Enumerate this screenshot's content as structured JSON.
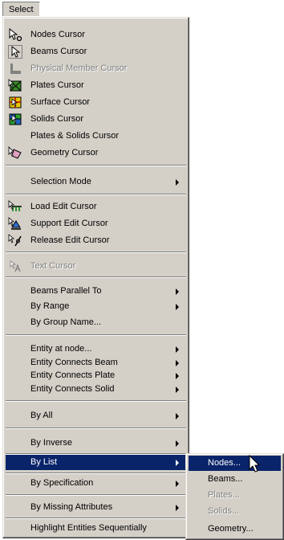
{
  "menu": {
    "title": "Select"
  },
  "items": {
    "nodes_cursor": "Nodes Cursor",
    "beams_cursor": "Beams Cursor",
    "physical_member_cursor": "Physical Member Cursor",
    "plates_cursor": "Plates Cursor",
    "surface_cursor": "Surface Cursor",
    "solids_cursor": "Solids Cursor",
    "plates_solids_cursor": "Plates & Solids Cursor",
    "geometry_cursor": "Geometry Cursor",
    "selection_mode": "Selection Mode",
    "load_edit_cursor": "Load Edit Cursor",
    "support_edit_cursor": "Support Edit Cursor",
    "release_edit_cursor": "Release Edit Cursor",
    "text_cursor": "Text Cursor",
    "beams_parallel_to": "Beams Parallel To",
    "by_range": "By Range",
    "by_group_name": "By Group Name...",
    "entity_at_node": "Entity at node...",
    "entity_connects_beam": "Entity Connects Beam",
    "entity_connects_plate": "Entity Connects Plate",
    "entity_connects_solid": "Entity Connects Solid",
    "by_all": "By All",
    "by_inverse": "By Inverse",
    "by_list": "By List",
    "by_specification": "By Specification",
    "by_missing_attributes": "By Missing Attributes",
    "highlight_entities": "Highlight Entities Sequentially"
  },
  "submenu": {
    "nodes": "Nodes...",
    "beams": "Beams...",
    "plates": "Plates...",
    "solids": "Solids...",
    "geometry": "Geometry..."
  },
  "colors": {
    "menu_bg": "#d4d0c8",
    "highlight": "#0a246a",
    "disabled_text": "#808080"
  },
  "icons": [
    "nodes-cursor-icon",
    "beams-cursor-icon",
    "physical-member-icon",
    "plates-cursor-icon",
    "surface-cursor-icon",
    "solids-cursor-icon",
    "geometry-cursor-icon",
    "load-edit-icon",
    "support-edit-icon",
    "release-edit-icon",
    "text-cursor-icon"
  ]
}
